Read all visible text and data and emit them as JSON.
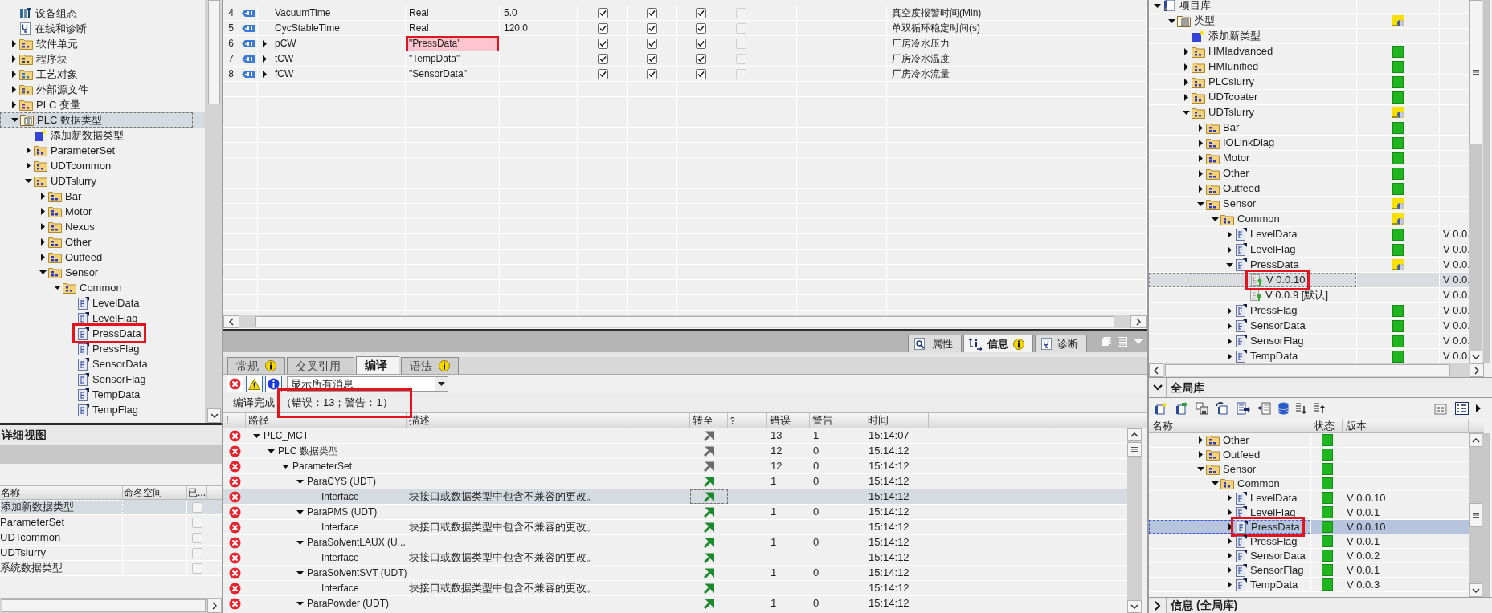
{
  "left_tree": [
    {
      "label": "设备组态",
      "kind": "device",
      "selected": false,
      "marked": false
    },
    {
      "label": "在线和诊断",
      "kind": "diagnostics",
      "selected": false,
      "marked": false
    },
    {
      "label": "软件单元",
      "kind": "software",
      "expanded": false,
      "selected": false,
      "marked": false
    },
    {
      "label": "程序块",
      "kind": "blocks",
      "expanded": false,
      "selected": false,
      "marked": false
    },
    {
      "label": "工艺对象",
      "kind": "techobj",
      "expanded": false,
      "selected": false,
      "marked": false
    },
    {
      "label": "外部源文件",
      "kind": "source",
      "expanded": false,
      "selected": false,
      "marked": false
    },
    {
      "label": "PLC 变量",
      "kind": "tags",
      "expanded": false,
      "selected": false,
      "marked": false
    },
    {
      "label": "PLC 数据类型",
      "kind": "types",
      "expanded": true,
      "selected": true,
      "marked": false,
      "children": [
        {
          "label": "添加新数据类型",
          "kind": "add",
          "selected": false,
          "marked": false
        },
        {
          "label": "ParameterSet",
          "kind": "folder",
          "expanded": false,
          "selected": false,
          "marked": false
        },
        {
          "label": "UDTcommon",
          "kind": "folder",
          "expanded": false,
          "selected": false,
          "marked": false
        },
        {
          "label": "UDTslurry",
          "kind": "folder",
          "expanded": true,
          "selected": false,
          "marked": false,
          "children": [
            {
              "label": "Bar",
              "kind": "folder",
              "expanded": false,
              "selected": false,
              "marked": false
            },
            {
              "label": "Motor",
              "kind": "folder",
              "expanded": false,
              "selected": false,
              "marked": false
            },
            {
              "label": "Nexus",
              "kind": "folder",
              "expanded": false,
              "selected": false,
              "marked": false
            },
            {
              "label": "Other",
              "kind": "folder",
              "expanded": false,
              "selected": false,
              "marked": false
            },
            {
              "label": "Outfeed",
              "kind": "folder",
              "expanded": false,
              "selected": false,
              "marked": false
            },
            {
              "label": "Sensor",
              "kind": "folder",
              "expanded": true,
              "selected": false,
              "marked": false,
              "children": [
                {
                  "label": "Common",
                  "kind": "folder",
                  "expanded": true,
                  "selected": false,
                  "marked": false,
                  "children": [
                    {
                      "label": "LevelData",
                      "kind": "udt",
                      "selected": false,
                      "marked": false
                    },
                    {
                      "label": "LevelFlag",
                      "kind": "udt",
                      "selected": false,
                      "marked": false
                    },
                    {
                      "label": "PressData",
                      "kind": "udt",
                      "selected": false,
                      "marked": true
                    },
                    {
                      "label": "PressFlag",
                      "kind": "udt",
                      "selected": false,
                      "marked": false
                    },
                    {
                      "label": "SensorData",
                      "kind": "udt",
                      "selected": false,
                      "marked": false
                    },
                    {
                      "label": "SensorFlag",
                      "kind": "udt",
                      "selected": false,
                      "marked": false
                    },
                    {
                      "label": "TempData",
                      "kind": "udt",
                      "selected": false,
                      "marked": false
                    },
                    {
                      "label": "TempFlag",
                      "kind": "udt",
                      "selected": false,
                      "marked": false
                    }
                  ]
                }
              ]
            }
          ]
        }
      ]
    }
  ],
  "detail_view": {
    "title": "详细视图",
    "columns": [
      "名称",
      "命名空间",
      "已..."
    ],
    "rows": [
      {
        "name": "添加新数据类型",
        "selected": true,
        "checked": false
      },
      {
        "name": "ParameterSet",
        "selected": false,
        "checked": false
      },
      {
        "name": "UDTcommon",
        "selected": false,
        "checked": false
      },
      {
        "name": "UDTslurry",
        "selected": false,
        "checked": false
      },
      {
        "name": "系统数据类型",
        "selected": false,
        "checked": false
      }
    ]
  },
  "variables_table": {
    "rows": [
      {
        "number": "4",
        "name": "VacuumTime",
        "data_type": "Real",
        "default_value": "5.0",
        "expandable": false,
        "highlighted": false,
        "marked": false,
        "flags": [
          {
            "checked": true,
            "disabled": false
          },
          {
            "checked": true,
            "disabled": false
          },
          {
            "checked": true,
            "disabled": false
          },
          {
            "checked": false,
            "disabled": true
          }
        ],
        "comment": "真空度报警时间(Min)"
      },
      {
        "number": "5",
        "name": "CycStableTime",
        "data_type": "Real",
        "default_value": "120.0",
        "expandable": false,
        "highlighted": false,
        "marked": false,
        "flags": [
          {
            "checked": true,
            "disabled": false
          },
          {
            "checked": true,
            "disabled": false
          },
          {
            "checked": true,
            "disabled": false
          },
          {
            "checked": false,
            "disabled": true
          }
        ],
        "comment": "单双循环稳定时间(s)"
      },
      {
        "number": "6",
        "name": "pCW",
        "data_type": "\"PressData\"",
        "expandable": true,
        "highlighted": true,
        "marked": true,
        "flags": [
          {
            "checked": true,
            "disabled": false
          },
          {
            "checked": true,
            "disabled": false
          },
          {
            "checked": true,
            "disabled": false
          },
          {
            "checked": false,
            "disabled": true
          }
        ],
        "comment": "厂房冷水压力"
      },
      {
        "number": "7",
        "name": "tCW",
        "data_type": "\"TempData\"",
        "expandable": true,
        "highlighted": false,
        "marked": false,
        "flags": [
          {
            "checked": true,
            "disabled": false
          },
          {
            "checked": true,
            "disabled": false
          },
          {
            "checked": true,
            "disabled": false
          },
          {
            "checked": false,
            "disabled": true
          }
        ],
        "comment": "厂房冷水温度"
      },
      {
        "number": "8",
        "name": "fCW",
        "data_type": "\"SensorData\"",
        "expandable": true,
        "highlighted": false,
        "marked": false,
        "flags": [
          {
            "checked": true,
            "disabled": false
          },
          {
            "checked": true,
            "disabled": false
          },
          {
            "checked": true,
            "disabled": false
          },
          {
            "checked": false,
            "disabled": true
          }
        ],
        "comment": "厂房冷水流量"
      }
    ]
  },
  "inspector_tabs": [
    {
      "label": "属性",
      "badge": false,
      "selected": false
    },
    {
      "label": "信息",
      "badge": true,
      "selected": true
    },
    {
      "label": "诊断",
      "badge": false,
      "selected": false
    }
  ],
  "compile_tabs": [
    {
      "label": "常规",
      "badge": true,
      "selected": false
    },
    {
      "label": "交叉引用",
      "badge": false,
      "selected": false
    },
    {
      "label": "编译",
      "badge": false,
      "selected": true
    },
    {
      "label": "语法",
      "badge": true,
      "selected": false
    }
  ],
  "filter_buttons": [
    {
      "kind": "error",
      "on": true
    },
    {
      "kind": "warning",
      "on": true
    },
    {
      "kind": "info",
      "on": true
    }
  ],
  "filter_dropdown": {
    "value": "显示所有消息"
  },
  "compile_status": {
    "text": "编译完成",
    "counts": "（错误：13；警告：1）",
    "marked": true
  },
  "message_columns": [
    "!",
    "路径",
    "描述",
    "转至",
    "?",
    "错误",
    "警告",
    "时间"
  ],
  "messages": [
    {
      "kind": "group",
      "path": "PLC_MCT",
      "errors": "13",
      "warnings": "1",
      "time": "15:14:07",
      "expanded": true,
      "selected": false,
      "children": [
        {
          "kind": "group",
          "path": "PLC 数据类型",
          "errors": "12",
          "warnings": "0",
          "time": "15:14:12",
          "expanded": true,
          "selected": false,
          "children": [
            {
              "kind": "group",
              "path": "ParameterSet",
              "errors": "12",
              "warnings": "0",
              "time": "15:14:12",
              "expanded": true,
              "selected": false,
              "children": [
                {
                  "kind": "object",
                  "path": "ParaCYS (UDT)",
                  "errors": "1",
                  "warnings": "0",
                  "time": "15:14:12",
                  "expanded": true,
                  "selected": false,
                  "children": [
                    {
                      "kind": "object",
                      "path": "Interface",
                      "description": "块接口或数据类型中包含不兼容的更改。",
                      "time": "15:14:12",
                      "selected": true
                    }
                  ]
                },
                {
                  "kind": "object",
                  "path": "ParaPMS (UDT)",
                  "errors": "1",
                  "warnings": "0",
                  "time": "15:14:12",
                  "expanded": true,
                  "selected": false,
                  "children": [
                    {
                      "kind": "object",
                      "path": "Interface",
                      "description": "块接口或数据类型中包含不兼容的更改。",
                      "time": "15:14:12",
                      "selected": false
                    }
                  ]
                },
                {
                  "kind": "object",
                  "path": "ParaSolventLAUX (U...",
                  "errors": "1",
                  "warnings": "0",
                  "time": "15:14:12",
                  "expanded": true,
                  "selected": false,
                  "children": [
                    {
                      "kind": "object",
                      "path": "Interface",
                      "description": "块接口或数据类型中包含不兼容的更改。",
                      "time": "15:14:12",
                      "selected": false
                    }
                  ]
                },
                {
                  "kind": "object",
                  "path": "ParaSolventSVT (UDT)",
                  "errors": "1",
                  "warnings": "0",
                  "time": "15:14:12",
                  "expanded": true,
                  "selected": false,
                  "children": [
                    {
                      "kind": "object",
                      "path": "Interface",
                      "description": "块接口或数据类型中包含不兼容的更改。",
                      "time": "15:14:12",
                      "selected": false
                    }
                  ]
                },
                {
                  "kind": "object",
                  "path": "ParaPowder (UDT)",
                  "errors": "1",
                  "warnings": "0",
                  "time": "15:14:12",
                  "expanded": true,
                  "selected": false
                }
              ]
            }
          ]
        }
      ]
    }
  ],
  "project_library": [
    {
      "label": "项目库",
      "kind": "library",
      "expanded": true,
      "selected": false,
      "marked": false,
      "children": [
        {
          "label": "类型",
          "kind": "types",
          "expanded": true,
          "up_to_date": false,
          "selected": false,
          "marked": false,
          "children": [
            {
              "label": "添加新类型",
              "kind": "add",
              "selected": false,
              "marked": false
            },
            {
              "label": "HMIadvanced",
              "kind": "folder",
              "expanded": false,
              "up_to_date": true,
              "selected": false,
              "marked": false
            },
            {
              "label": "HMIunified",
              "kind": "folder",
              "expanded": false,
              "up_to_date": true,
              "selected": false,
              "marked": false
            },
            {
              "label": "PLCslurry",
              "kind": "folder",
              "expanded": false,
              "up_to_date": true,
              "selected": false,
              "marked": false
            },
            {
              "label": "UDTcoater",
              "kind": "folder",
              "expanded": false,
              "up_to_date": true,
              "selected": false,
              "marked": false
            },
            {
              "label": "UDTslurry",
              "kind": "folder",
              "expanded": true,
              "up_to_date": false,
              "selected": false,
              "marked": false,
              "children": [
                {
                  "label": "Bar",
                  "kind": "folder",
                  "expanded": false,
                  "up_to_date": true,
                  "selected": false,
                  "marked": false
                },
                {
                  "label": "IOLinkDiag",
                  "kind": "folder",
                  "expanded": false,
                  "up_to_date": true,
                  "selected": false,
                  "marked": false
                },
                {
                  "label": "Motor",
                  "kind": "folder",
                  "expanded": false,
                  "up_to_date": true,
                  "selected": false,
                  "marked": false
                },
                {
                  "label": "Other",
                  "kind": "folder",
                  "expanded": false,
                  "up_to_date": true,
                  "selected": false,
                  "marked": false
                },
                {
                  "label": "Outfeed",
                  "kind": "folder",
                  "expanded": false,
                  "up_to_date": true,
                  "selected": false,
                  "marked": false
                },
                {
                  "label": "Sensor",
                  "kind": "folder",
                  "expanded": true,
                  "up_to_date": false,
                  "selected": false,
                  "marked": false,
                  "children": [
                    {
                      "label": "Common",
                      "kind": "folder",
                      "expanded": true,
                      "up_to_date": false,
                      "selected": false,
                      "marked": false,
                      "children": [
                        {
                          "label": "LevelData",
                          "kind": "udt",
                          "expanded": false,
                          "up_to_date": true,
                          "version": "V 0.0.",
                          "selected": false,
                          "marked": false
                        },
                        {
                          "label": "LevelFlag",
                          "kind": "udt",
                          "expanded": false,
                          "up_to_date": true,
                          "version": "V 0.0.",
                          "selected": false,
                          "marked": false
                        },
                        {
                          "label": "PressData",
                          "kind": "udt",
                          "expanded": true,
                          "up_to_date": false,
                          "version": "V 0.0.",
                          "selected": false,
                          "marked": false,
                          "children": [
                            {
                              "label": "V 0.0.10",
                              "kind": "version",
                              "version": "V 0.0.",
                              "selected": true,
                              "marked": true
                            },
                            {
                              "label": "V 0.0.9 [默认]",
                              "kind": "version",
                              "version": "V 0.0.",
                              "selected": false,
                              "marked": false
                            }
                          ]
                        },
                        {
                          "label": "PressFlag",
                          "kind": "udt",
                          "expanded": false,
                          "up_to_date": true,
                          "version": "V 0.0.",
                          "selected": false,
                          "marked": false
                        },
                        {
                          "label": "SensorData",
                          "kind": "udt",
                          "expanded": false,
                          "up_to_date": true,
                          "version": "V 0.0.",
                          "selected": false,
                          "marked": false
                        },
                        {
                          "label": "SensorFlag",
                          "kind": "udt",
                          "expanded": false,
                          "up_to_date": true,
                          "version": "V 0.0.",
                          "selected": false,
                          "marked": false
                        },
                        {
                          "label": "TempData",
                          "kind": "udt",
                          "expanded": false,
                          "up_to_date": true,
                          "version": "V 0.0.",
                          "selected": false,
                          "marked": false
                        }
                      ]
                    }
                  ]
                }
              ]
            }
          ]
        }
      ]
    }
  ],
  "global_library": {
    "title": "全局库",
    "expanded": true,
    "columns": [
      "名称",
      "状态",
      "版本"
    ],
    "tree": [
      {
        "label": "Other",
        "kind": "folder",
        "expanded": false,
        "up_to_date": true,
        "selected": false,
        "marked": false
      },
      {
        "label": "Outfeed",
        "kind": "folder",
        "expanded": false,
        "up_to_date": true,
        "selected": false,
        "marked": false
      },
      {
        "label": "Sensor",
        "kind": "folder",
        "expanded": true,
        "up_to_date": true,
        "selected": false,
        "marked": false,
        "children": [
          {
            "label": "Common",
            "kind": "folder",
            "expanded": true,
            "up_to_date": true,
            "selected": false,
            "marked": false,
            "children": [
              {
                "label": "LevelData",
                "kind": "udt",
                "expanded": false,
                "up_to_date": true,
                "version": "V 0.0.10",
                "selected": false,
                "marked": false
              },
              {
                "label": "LevelFlag",
                "kind": "udt",
                "expanded": false,
                "up_to_date": true,
                "version": "V 0.0.1",
                "selected": false,
                "marked": false
              },
              {
                "label": "PressData",
                "kind": "udt",
                "expanded": false,
                "up_to_date": true,
                "version": "V 0.0.10",
                "selected": true,
                "marked": true
              },
              {
                "label": "PressFlag",
                "kind": "udt",
                "expanded": false,
                "up_to_date": true,
                "version": "V 0.0.1",
                "selected": false,
                "marked": false
              },
              {
                "label": "SensorData",
                "kind": "udt",
                "expanded": false,
                "up_to_date": true,
                "version": "V 0.0.2",
                "selected": false,
                "marked": false
              },
              {
                "label": "SensorFlag",
                "kind": "udt",
                "expanded": false,
                "up_to_date": true,
                "version": "V 0.0.1",
                "selected": false,
                "marked": false
              },
              {
                "label": "TempData",
                "kind": "udt",
                "expanded": false,
                "up_to_date": true,
                "version": "V 0.0.3",
                "selected": false,
                "marked": false
              }
            ]
          }
        ]
      }
    ]
  },
  "info_pane": {
    "title": "信息 (全局库)",
    "expanded": false
  }
}
